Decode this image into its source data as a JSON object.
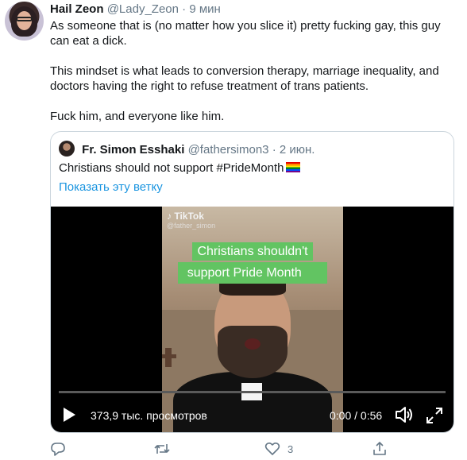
{
  "tweet": {
    "author_name": "Hail Zeon",
    "author_handle": "@Lady_Zeon",
    "separator": "·",
    "time": "9 мин",
    "paragraphs": [
      "As someone that is (no matter how you slice it) pretty fucking gay, this guy can eat a dick.",
      "This mindset is what leads to conversion therapy, marriage inequality, and doctors having the right to refuse treatment of trans patients.",
      "Fuck him, and everyone like him."
    ]
  },
  "quoted_tweet": {
    "author_name": "Fr. Simon Esshaki",
    "author_handle": "@fathersimon3",
    "separator": "·",
    "date": "2 июн.",
    "text": "Christians should not support #PrideMonth",
    "show_thread": "Показать эту ветку",
    "video": {
      "tiktok_logo": "TikTok",
      "tiktok_handle": "@father_simon",
      "caption_line1": "Christians shouldn't",
      "caption_line2": "support Pride Month",
      "views": "373,9 тыс. просмотров",
      "time": "0:00 / 0:56",
      "progress": 0
    }
  },
  "actions": {
    "like_count": "3",
    "icons": [
      "reply-icon",
      "retweet-icon",
      "like-icon",
      "share-icon"
    ]
  },
  "colors": {
    "link": "#1b95e0",
    "muted": "#657786",
    "caption_bg": "#62c462"
  }
}
